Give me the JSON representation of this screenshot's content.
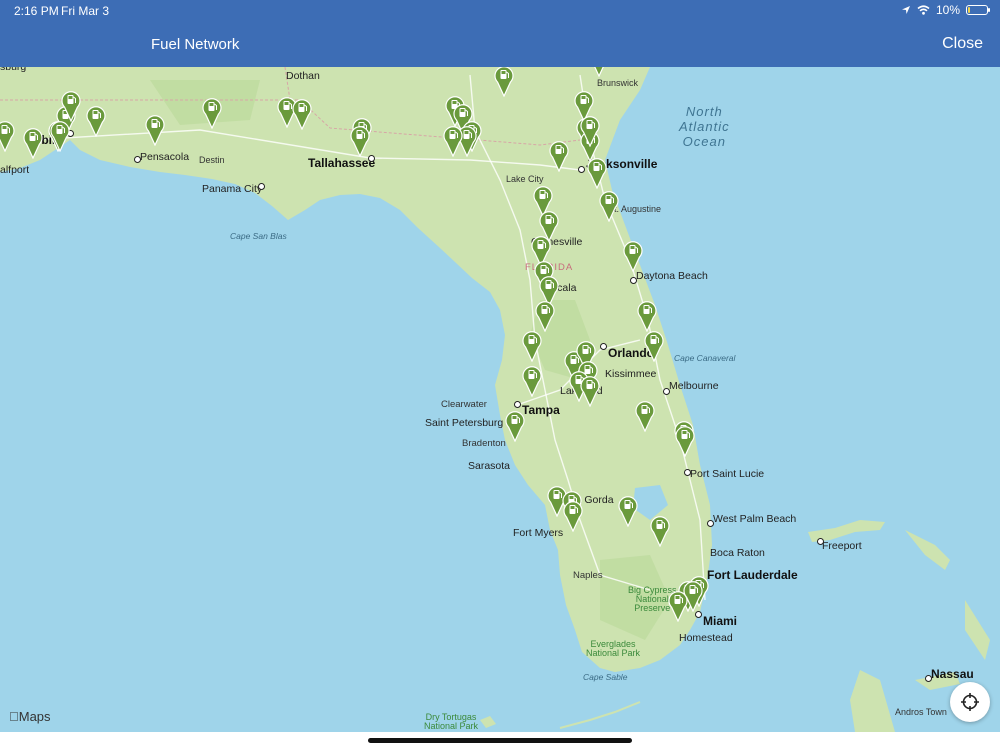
{
  "status": {
    "time": "2:16 PM",
    "date": "Fri Mar 3",
    "battery": "10%",
    "battery_level": 0.1,
    "icons": [
      "location-arrow-icon",
      "wifi-icon",
      "battery-icon"
    ]
  },
  "nav": {
    "title": "Fuel Network",
    "close_label": "Close"
  },
  "map": {
    "attribution": "Maps",
    "colors": {
      "water": "#9fd4ea",
      "land": "#cde3b0",
      "pin": "#6a9a3c",
      "bar": "#3d6db5"
    },
    "labels": {
      "ocean": [
        "North",
        "Atlantic",
        "Ocean"
      ],
      "gulf_port": "alfport",
      "mobile": "obile",
      "top_left": "sburg",
      "dothan": "Dothan",
      "brunswick": "Brunswick",
      "pensacola": "Pensacola",
      "destin": "Destin",
      "tallahassee": "Tallahassee",
      "jacksonville": "Jacksonville",
      "lake_city": "Lake City",
      "panama_city": "Panama City",
      "st_augustine": "St. Augustine",
      "cape_san_blas": "Cape San Blas",
      "gainesville": "Gainesville",
      "state": "FLORIDA",
      "ocala": "Ocala",
      "daytona": "Daytona Beach",
      "orlando": "Orlando",
      "cape_canaveral": "Cape Canaveral",
      "kissimmee": "Kissimmee",
      "melbourne": "Melbourne",
      "lakeland": "Lakeland",
      "clearwater": "Clearwater",
      "tampa": "Tampa",
      "st_petersburg": "Saint Petersburg",
      "bradenton": "Bradenton",
      "sarasota": "Sarasota",
      "port_st_lucie": "Port Saint Lucie",
      "punta_gorda": "Punta Gorda",
      "west_palm": "West Palm Beach",
      "fort_myers": "Fort Myers",
      "freeport": "Freeport",
      "boca_raton": "Boca Raton",
      "fort_lauderdale": "Fort Lauderdale",
      "naples": "Naples",
      "big_cypress": [
        "Big Cypress",
        "National",
        "Preserve"
      ],
      "miami": "Miami",
      "homestead": "Homestead",
      "everglades": [
        "Everglades",
        "National Park"
      ],
      "cape_sable": "Cape Sable",
      "nassau": "Nassau",
      "andros": "Andros Town",
      "dry_tortugas": [
        "Dry Tortugas",
        "National Park"
      ]
    },
    "fuel_station_count": 56
  }
}
